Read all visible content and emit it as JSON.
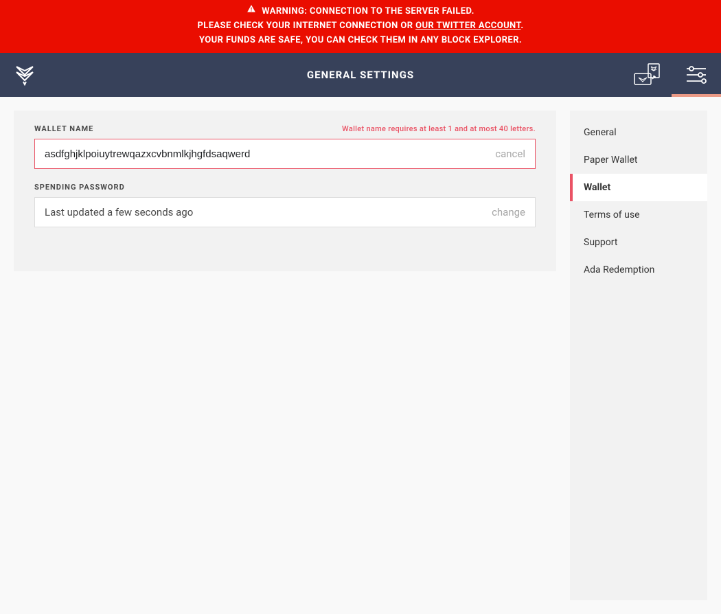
{
  "warning": {
    "line1": "WARNING: CONNECTION TO THE SERVER FAILED.",
    "line2_prefix": "PLEASE CHECK YOUR INTERNET CONNECTION OR ",
    "line2_link": "OUR TWITTER ACCOUNT",
    "line2_suffix": ".",
    "line3": "YOUR FUNDS ARE SAFE, YOU CAN CHECK THEM IN ANY BLOCK EXPLORER."
  },
  "header": {
    "title": "GENERAL SETTINGS"
  },
  "fields": {
    "wallet_name": {
      "label": "WALLET NAME",
      "error": "Wallet name requires at least 1 and at most 40 letters.",
      "value": "asdfghjklpoiuytrewqazxcvbnmlkjhgfdsaqwerd",
      "action": "cancel"
    },
    "spending_password": {
      "label": "SPENDING PASSWORD",
      "status": "Last updated a few seconds ago",
      "action": "change"
    }
  },
  "sidebar": {
    "items": [
      {
        "label": "General",
        "active": false
      },
      {
        "label": "Paper Wallet",
        "active": false
      },
      {
        "label": "Wallet",
        "active": true
      },
      {
        "label": "Terms of use",
        "active": false
      },
      {
        "label": "Support",
        "active": false
      },
      {
        "label": "Ada Redemption",
        "active": false
      }
    ]
  },
  "colors": {
    "warning_bg": "#ea0d00",
    "header_bg": "#37415a",
    "accent": "#ea5365",
    "active_tab_indicator": "#eb9a86",
    "panel_bg": "#f2f2f2"
  }
}
